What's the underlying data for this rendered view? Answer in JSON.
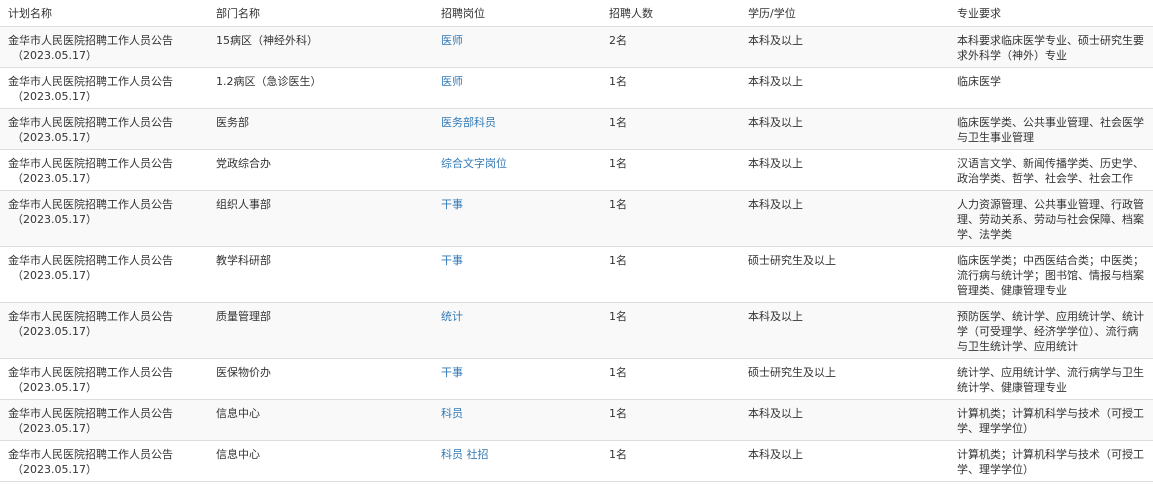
{
  "colors": {
    "link": "#337ab7",
    "stripe": "#f9f9f9",
    "border": "#dddddd",
    "text": "#333333"
  },
  "headers": [
    "计划名称",
    "部门名称",
    "招聘岗位",
    "招聘人数",
    "学历/学位",
    "专业要求"
  ],
  "rows": [
    {
      "plan": "金华市人民医院招聘工作人员公告",
      "date": "（2023.05.17）",
      "dept": "15病区（神经外科）",
      "post": "医师",
      "count": "2名",
      "edu": "本科及以上",
      "req": "本科要求临床医学专业、硕士研究生要求外科学（神外）专业"
    },
    {
      "plan": "金华市人民医院招聘工作人员公告",
      "date": "（2023.05.17）",
      "dept": "1.2病区（急诊医生）",
      "post": "医师",
      "count": "1名",
      "edu": "本科及以上",
      "req": "临床医学"
    },
    {
      "plan": "金华市人民医院招聘工作人员公告",
      "date": "（2023.05.17）",
      "dept": "医务部",
      "post": "医务部科员",
      "count": "1名",
      "edu": "本科及以上",
      "req": "临床医学类、公共事业管理、社会医学与卫生事业管理"
    },
    {
      "plan": "金华市人民医院招聘工作人员公告",
      "date": "（2023.05.17）",
      "dept": "党政综合办",
      "post": "综合文字岗位",
      "count": "1名",
      "edu": "本科及以上",
      "req": "汉语言文学、新闻传播学类、历史学、政治学类、哲学、社会学、社会工作"
    },
    {
      "plan": "金华市人民医院招聘工作人员公告",
      "date": "（2023.05.17）",
      "dept": "组织人事部",
      "post": "干事",
      "count": "1名",
      "edu": "本科及以上",
      "req": "人力资源管理、公共事业管理、行政管理、劳动关系、劳动与社会保障、档案学、法学类"
    },
    {
      "plan": "金华市人民医院招聘工作人员公告",
      "date": "（2023.05.17）",
      "dept": "教学科研部",
      "post": "干事",
      "count": "1名",
      "edu": "硕士研究生及以上",
      "req": "临床医学类；中西医结合类；中医类；流行病与统计学；图书馆、情报与档案管理类、健康管理专业"
    },
    {
      "plan": "金华市人民医院招聘工作人员公告",
      "date": "（2023.05.17）",
      "dept": "质量管理部",
      "post": "统计",
      "count": "1名",
      "edu": "本科及以上",
      "req": "预防医学、统计学、应用统计学、统计学（可受理学、经济学学位）、流行病与卫生统计学、应用统计"
    },
    {
      "plan": "金华市人民医院招聘工作人员公告",
      "date": "（2023.05.17）",
      "dept": "医保物价办",
      "post": "干事",
      "count": "1名",
      "edu": "硕士研究生及以上",
      "req": "统计学、应用统计学、流行病学与卫生统计学、健康管理专业"
    },
    {
      "plan": "金华市人民医院招聘工作人员公告",
      "date": "（2023.05.17）",
      "dept": "信息中心",
      "post": "科员",
      "count": "1名",
      "edu": "本科及以上",
      "req": "计算机类；计算机科学与技术（可授工学、理学学位）"
    },
    {
      "plan": "金华市人民医院招聘工作人员公告",
      "date": "（2023.05.17）",
      "dept": "信息中心",
      "post": "科员 社招",
      "count": "1名",
      "edu": "本科及以上",
      "req": "计算机类；计算机科学与技术（可授工学、理学学位）"
    }
  ]
}
